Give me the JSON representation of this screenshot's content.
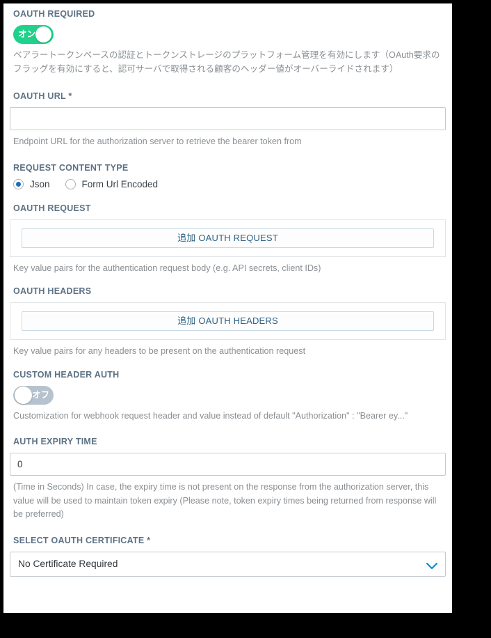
{
  "form": {
    "oauth_required": {
      "label": "OAUTH REQUIRED",
      "toggle_state_label": "オン",
      "help": "ベアラートークンベースの認証とトークンストレージのプラットフォーム管理を有効にします（OAuth要求のフラッグを有効にすると、認可サーバで取得される顧客のヘッダー値がオーバーライドされます）"
    },
    "oauth_url": {
      "label": "OAUTH URL *",
      "value": "",
      "placeholder": "",
      "help": "Endpoint URL for the authorization server to retrieve the bearer token from"
    },
    "request_content_type": {
      "label": "REQUEST CONTENT TYPE",
      "options": [
        {
          "label": "Json",
          "selected": true
        },
        {
          "label": "Form Url Encoded",
          "selected": false
        }
      ]
    },
    "oauth_request": {
      "label": "OAUTH REQUEST",
      "add_button_label": "追加 OAUTH REQUEST",
      "help": "Key value pairs for the authentication request body (e.g. API secrets, client IDs)"
    },
    "oauth_headers": {
      "label": "OAUTH HEADERS",
      "add_button_label": "追加 OAUTH HEADERS",
      "help": "Key value pairs for any headers to be present on the authentication request"
    },
    "custom_header_auth": {
      "label": "CUSTOM HEADER AUTH",
      "toggle_state_label": "オフ",
      "help": "Customization for webhook request header and value instead of default \"Authorization\" : \"Bearer ey...\""
    },
    "auth_expiry_time": {
      "label": "AUTH EXPIRY TIME",
      "value": "0",
      "placeholder": "",
      "help": "(Time in Seconds) In case, the expiry time is not present on the response from the authorization server, this value will be used to maintain token expiry (Please note, token expiry times being returned from response will be preferred)"
    },
    "select_oauth_certificate": {
      "label": "SELECT OAUTH CERTIFICATE *",
      "selected_value": "No Certificate Required"
    }
  },
  "colors": {
    "toggle_on": "#1fd18a",
    "toggle_off": "#b6c2ce",
    "label": "#5c7184",
    "help": "#8a8f94",
    "accent_blue": "#0d8bd9",
    "radio_blue": "#1a6cb8",
    "button_text": "#2d6285"
  }
}
